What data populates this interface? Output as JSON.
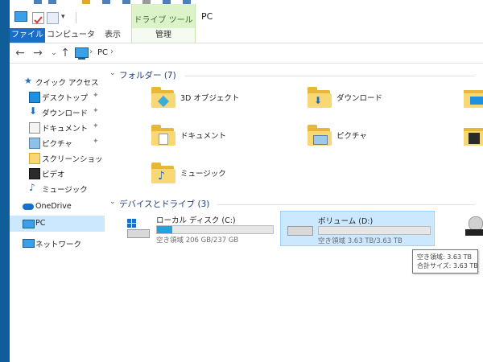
{
  "titlebar": {
    "quick_access_icons": [
      "properties-icon",
      "checkmark-icon",
      "new-folder-icon",
      "customize-dropdown-icon"
    ],
    "contextual_tab_group": "ドライブ ツール",
    "window_title": "PC"
  },
  "ribbon": {
    "tabs": [
      {
        "label": "ファイル",
        "active": true
      },
      {
        "label": "コンピューター"
      },
      {
        "label": "表示"
      },
      {
        "label": "管理"
      }
    ]
  },
  "address_bar": {
    "crumb": "PC",
    "sep1": "›",
    "sep2": "›"
  },
  "nav_pane": {
    "quick_access": "クイック アクセス",
    "items": [
      {
        "label": "デスクトップ",
        "pinned": true
      },
      {
        "label": "ダウンロード",
        "pinned": true
      },
      {
        "label": "ドキュメント",
        "pinned": true
      },
      {
        "label": "ピクチャ",
        "pinned": true
      },
      {
        "label": "スクリーンショット"
      },
      {
        "label": "ビデオ"
      },
      {
        "label": "ミュージック"
      }
    ],
    "onedrive": "OneDrive",
    "pc": "PC",
    "network": "ネットワーク",
    "pin_glyph": "📌"
  },
  "content": {
    "folders_header": "フォルダー (7)",
    "folders": [
      {
        "name": "3D オブジェクト",
        "icon": "3d-objects-icon"
      },
      {
        "name": "ダウンロード",
        "icon": "download-arrow-icon"
      },
      {
        "name": "ドキュメント",
        "icon": "document-icon"
      },
      {
        "name": "ピクチャ",
        "icon": "picture-icon"
      },
      {
        "name": "ミュージック",
        "icon": "music-note-icon"
      }
    ],
    "devices_header": "デバイスとドライブ (3)",
    "drives": [
      {
        "name": "ローカル ディスク (C:)",
        "free": "空き領域 206 GB/237 GB",
        "used_fraction": 0.13
      },
      {
        "name": "ボリューム (D:)",
        "free": "空き領域 3.63 TB/3.63 TB",
        "used_fraction": 0.0
      }
    ]
  },
  "tooltip": {
    "line1": "空き領域: 3.63 TB",
    "line2": "合計サイズ: 3.63 TB"
  },
  "colors": {
    "accent": "#1a6ec7",
    "selection": "#cce8ff",
    "drive_bar": "#26a0da",
    "contextual_tab": "#dcf3c9",
    "desktop": "#0f5e9a"
  }
}
